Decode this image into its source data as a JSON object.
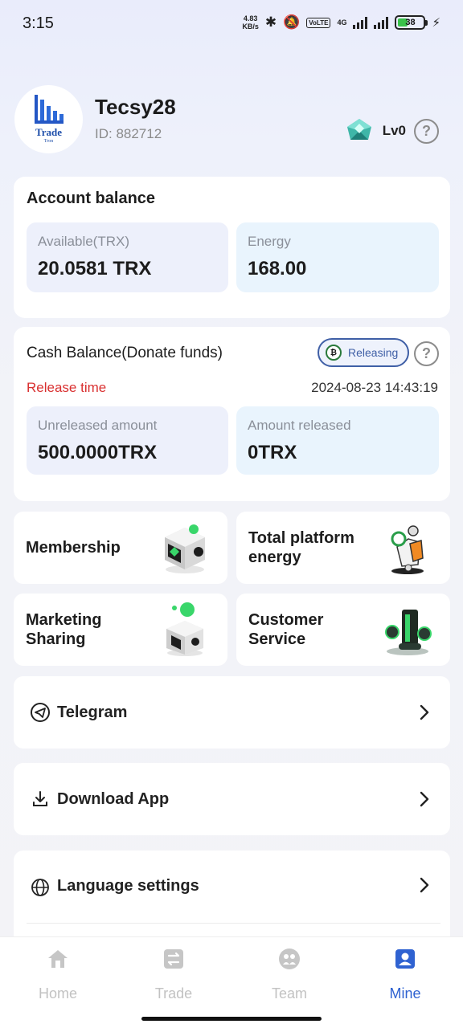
{
  "status_bar": {
    "time": "3:15",
    "speed_value": "4.83",
    "speed_unit": "KB/s",
    "volte": "VoLTE",
    "network": "4G",
    "battery": "38",
    "battery_level": 0.38
  },
  "profile": {
    "logo_text": "Trade",
    "logo_sub": "Tron",
    "username": "Tecsy28",
    "id_text": "ID: 882712",
    "level": "Lv0"
  },
  "account_balance": {
    "title": "Account balance",
    "available_label": "Available(TRX)",
    "available_value": "20.0581 TRX",
    "energy_label": "Energy",
    "energy_value": "168.00"
  },
  "cash_balance": {
    "title": "Cash Balance(Donate funds)",
    "status_pill": "Releasing",
    "release_time_label": "Release time",
    "release_time_value": "2024-08-23 14:43:19",
    "unreleased_label": "Unreleased amount",
    "unreleased_value": "500.0000TRX",
    "released_label": "Amount released",
    "released_value": "0TRX"
  },
  "grid": [
    {
      "line1": "Membership",
      "line2": "",
      "icon": "membership-icon"
    },
    {
      "line1": "Total platform",
      "line2": "energy",
      "icon": "platform-energy-icon"
    },
    {
      "line1": "Marketing",
      "line2": "Sharing",
      "icon": "marketing-sharing-icon"
    },
    {
      "line1": "Customer",
      "line2": "Service",
      "icon": "customer-service-icon"
    }
  ],
  "menu": [
    {
      "label": "Telegram",
      "icon": "telegram-icon"
    },
    {
      "label": "Download App",
      "icon": "download-icon"
    },
    {
      "label": "Language settings",
      "icon": "globe-icon"
    }
  ],
  "tabs": [
    {
      "label": "Home",
      "icon": "home-icon"
    },
    {
      "label": "Trade",
      "icon": "trade-icon"
    },
    {
      "label": "Team",
      "icon": "team-icon"
    },
    {
      "label": "Mine",
      "icon": "mine-icon"
    }
  ],
  "colors": {
    "accent": "#2f62d1",
    "release_time_red": "#d93030",
    "tab_inactive": "#c2c2c2"
  }
}
